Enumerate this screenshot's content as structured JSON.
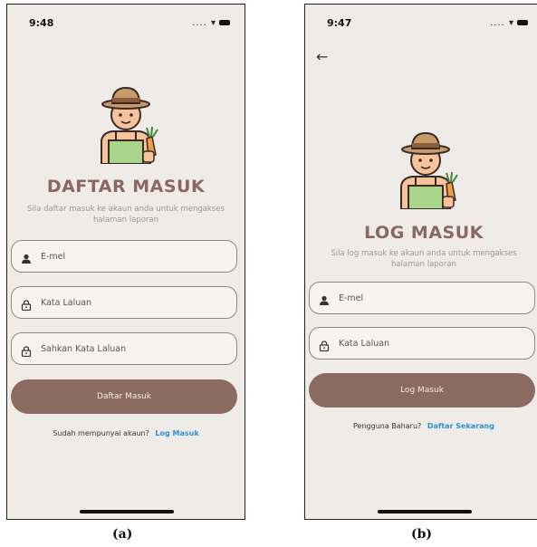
{
  "screen_a": {
    "status_time": "9:48",
    "title": "DAFTAR MASUK",
    "subtitle": "Sila daftar masuk ke akaun anda untuk mengakses halaman laporan",
    "email_placeholder": "E-mel",
    "password_placeholder": "Kata Laluan",
    "confirm_placeholder": "Sahkan Kata Laluan",
    "button_label": "Daftar Masuk",
    "footer_text": "Sudah mempunyai akaun?",
    "footer_link": "Log Masuk",
    "caption": "(a)"
  },
  "screen_b": {
    "status_time": "9:47",
    "back_icon": "←",
    "title": "LOG MASUK",
    "subtitle": "Sila log masuk ke akaun anda untuk mengakses halaman laporan",
    "email_placeholder": "E-mel",
    "password_placeholder": "Kata Laluan",
    "button_label": "Log Masuk",
    "footer_text": "Pengguna Baharu?",
    "footer_link": "Daftar Sekarang",
    "caption": "(b)"
  },
  "colors": {
    "background": "#efebe7",
    "accent": "#8b6a62",
    "link": "#2a90d6"
  }
}
